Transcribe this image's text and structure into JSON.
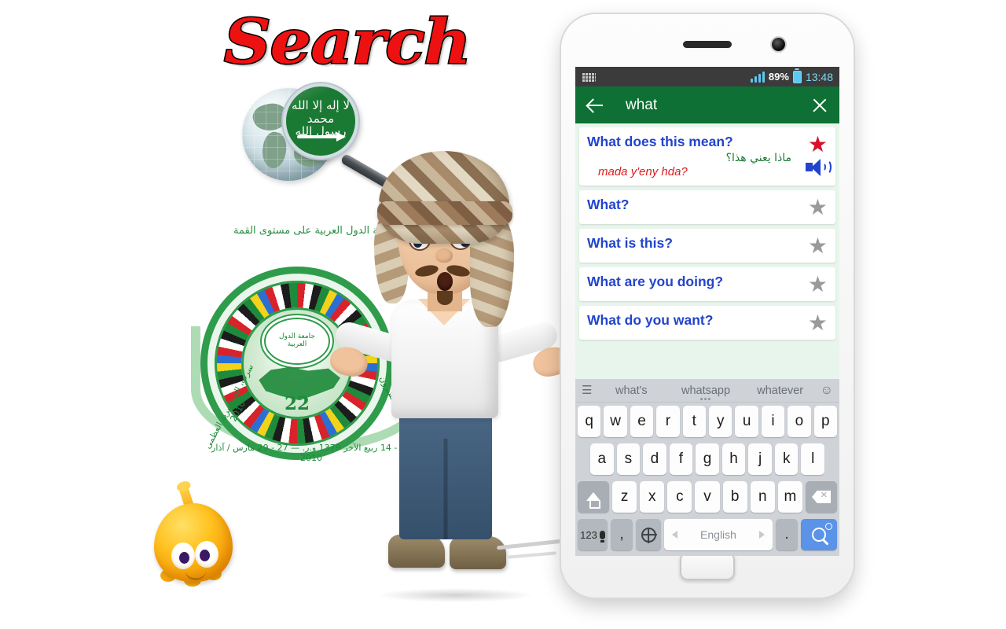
{
  "promo": {
    "title": "Search"
  },
  "artwork": {
    "globe_icon": "globe-magnifier-saudi-flag-icon",
    "emblem": {
      "top_arabic": "قمة الدول العربية على مستوى القمة",
      "session_number": "22",
      "center_arabic": "جامعة الدول العربية",
      "right_arabic": "الدورة الثانية والعشرون",
      "left_arabic": "سرت، الجماهيرية العظمى 2010",
      "bottom_arabic": "12 - 14 ربيع الآخر 1379 و.ر. — 27 - 29 مارس / آذار 2010"
    },
    "mascot_icon": "orange-blob-mascot-icon",
    "character_icon": "arab-man-cartoon-character"
  },
  "phone": {
    "status_bar": {
      "keyboard_icon": "keyboard-icon",
      "signal_icon": "signal-bars-icon",
      "battery_percent": "89%",
      "battery_icon": "battery-icon",
      "time": "13:48"
    },
    "action_bar": {
      "back_icon": "back-arrow-icon",
      "query": "what",
      "clear_icon": "close-icon"
    },
    "results": [
      {
        "english": "What does this mean?",
        "arabic": "ماذا يعني هذا؟",
        "transliteration": "mada y'eny hda?",
        "starred": true,
        "star_icon": "star-filled-icon",
        "speaker_icon": "speaker-icon"
      },
      {
        "english": "What?",
        "starred": false,
        "star_icon": "star-icon"
      },
      {
        "english": "What is this?",
        "starred": false,
        "star_icon": "star-icon"
      },
      {
        "english": "What are you doing?",
        "starred": false,
        "star_icon": "star-icon"
      },
      {
        "english": "What do you want?",
        "starred": false,
        "star_icon": "star-icon"
      }
    ],
    "keyboard": {
      "menu_icon": "hamburger-menu-icon",
      "suggestions": [
        "what's",
        "whatsapp",
        "whatever"
      ],
      "suggestion_dots": "•••",
      "emoji_icon": "smiley-icon",
      "row1": [
        "q",
        "w",
        "e",
        "r",
        "t",
        "y",
        "u",
        "i",
        "o",
        "p"
      ],
      "row2": [
        "a",
        "s",
        "d",
        "f",
        "g",
        "h",
        "j",
        "k",
        "l"
      ],
      "row3": [
        "z",
        "x",
        "c",
        "v",
        "b",
        "n",
        "m"
      ],
      "shift_icon": "shift-icon",
      "backspace_icon": "backspace-icon",
      "numbers_label": "123",
      "mic_icon": "microphone-icon",
      "comma_label": ",",
      "globe_icon": "language-globe-icon",
      "space_label": "English",
      "space_prev_icon": "arrow-left-icon",
      "space_next_icon": "arrow-right-icon",
      "period_label": ".",
      "search_icon": "search-icon",
      "search_settings_icon": "settings-dot-icon"
    },
    "home_button": "home-button"
  },
  "colors": {
    "accent_green": "#0e7034",
    "result_blue": "#2244cc",
    "arabic_green": "#1a7a34",
    "translit_red": "#e01b1b",
    "star_red": "#d81028",
    "star_grey": "#9a9a9a",
    "keyboard_bg": "#cfd3d8",
    "search_key_blue": "#5b93e8",
    "title_red": "#ee1111"
  }
}
